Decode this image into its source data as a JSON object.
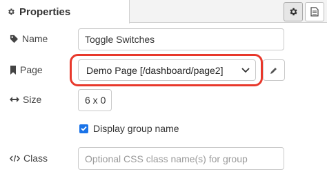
{
  "tabs": {
    "properties_label": "Properties",
    "gear_button_icon": "gear-icon",
    "doc_button_icon": "document-icon"
  },
  "form": {
    "name_label": "Name",
    "name_value": "Toggle Switches",
    "page_label": "Page",
    "page_selected": "Demo Page [/dashboard/page2]",
    "size_label": "Size",
    "size_value": "6 x 0",
    "display_group_name_label": "Display group name",
    "display_group_name_checked": true,
    "class_label": "Class",
    "class_placeholder": "Optional CSS class name(s) for group"
  },
  "colors": {
    "highlight": "#e8382b",
    "checkbox": "#1a73e8"
  }
}
